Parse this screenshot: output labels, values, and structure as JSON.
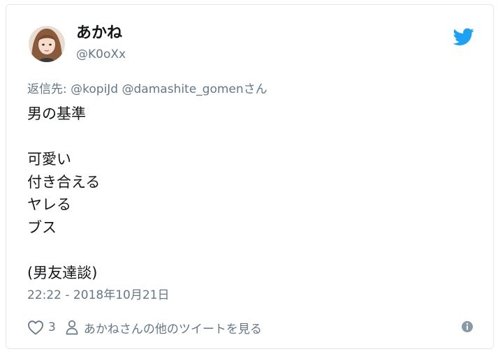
{
  "author": {
    "display_name": "あかね",
    "handle": "@K0oXx",
    "avatar_icon": "avatar-photo"
  },
  "reply": {
    "prefix": "返信先: ",
    "mentions": [
      "@kopiJd",
      "@damashite_gomen"
    ],
    "suffix": "さん"
  },
  "tweet": {
    "lines": [
      "男の基準",
      "",
      "可愛い",
      "付き合える",
      "ヤレる",
      "ブス",
      "",
      "(男友達談)"
    ]
  },
  "timestamp": "22:22 - 2018年10月21日",
  "footer": {
    "like_icon": "heart-icon",
    "like_count": "3",
    "profile_icon": "person-icon",
    "profile_link_text": "あかねさんの他のツイートを見る",
    "info_icon": "info-icon"
  },
  "colors": {
    "twitter_blue": "#1da1f2",
    "text_primary": "#14171a",
    "text_secondary": "#657786",
    "border": "#e1e8ed"
  }
}
